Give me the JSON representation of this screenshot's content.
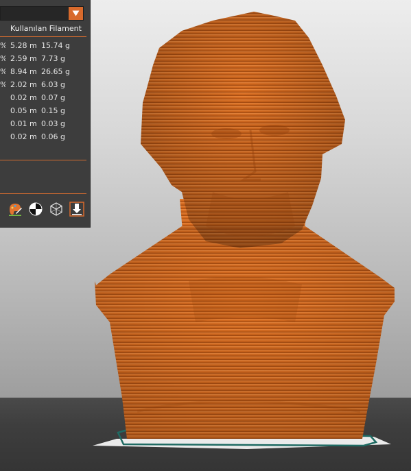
{
  "panel": {
    "dropdown_value": "",
    "header": {
      "pct_col": "",
      "filament_col": "Kullanılan Filament"
    },
    "rows": [
      {
        "pct": "%",
        "length": "5.28 m",
        "weight": "15.74 g"
      },
      {
        "pct": "%",
        "length": "2.59 m",
        "weight": "7.73 g"
      },
      {
        "pct": "%",
        "length": "8.94 m",
        "weight": "26.65 g"
      },
      {
        "pct": "%",
        "length": "2.02 m",
        "weight": "6.03 g"
      },
      {
        "pct": "",
        "length": "0.02 m",
        "weight": "0.07 g"
      },
      {
        "pct": "",
        "length": "0.05 m",
        "weight": "0.15 g"
      },
      {
        "pct": "",
        "length": "0.01 m",
        "weight": "0.03 g"
      },
      {
        "pct": "",
        "length": "0.02 m",
        "weight": "0.06 g"
      }
    ],
    "tools": [
      {
        "icon": "paint-tool-icon"
      },
      {
        "icon": "color-wheel-icon"
      },
      {
        "icon": "cube-wireframe-icon"
      },
      {
        "icon": "export-download-icon"
      }
    ]
  },
  "colors": {
    "accent": "#d86a2c",
    "model": "#d2691e",
    "panel_bg": "#3d3d3d",
    "plate_outline": "#1f6b63"
  },
  "viewport": {
    "model": "bust-3d-model"
  }
}
